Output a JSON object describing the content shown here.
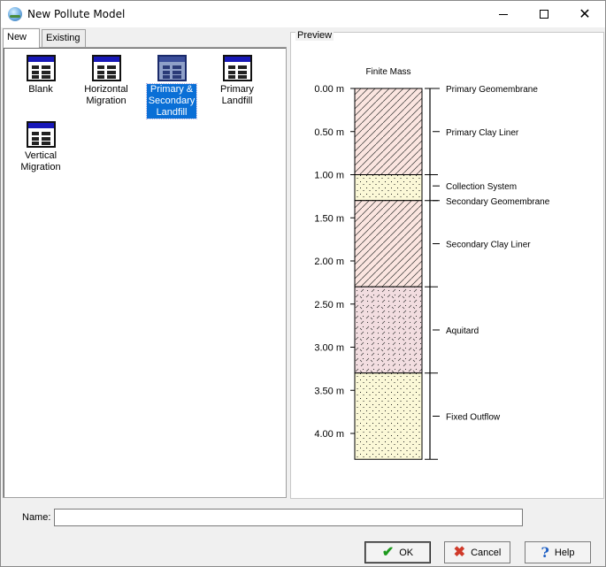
{
  "window": {
    "title": "New Pollute Model"
  },
  "tabs": [
    {
      "label": "New"
    },
    {
      "label": "Existing"
    }
  ],
  "models": [
    {
      "label_lines": [
        "Blank"
      ]
    },
    {
      "label_lines": [
        "Horizontal",
        "Migration"
      ]
    },
    {
      "label_lines": [
        "Primary &",
        "Secondary",
        "Landfill"
      ],
      "selected": true
    },
    {
      "label_lines": [
        "Primary",
        "Landfill"
      ]
    },
    {
      "label_lines": [
        "Vertical",
        "Migration"
      ]
    }
  ],
  "preview": {
    "legend": "Preview",
    "column_title": "Finite Mass",
    "depth_ticks": [
      "0.00 m",
      "0.50 m",
      "1.00 m",
      "1.50 m",
      "2.00 m",
      "2.50 m",
      "3.00 m",
      "3.50 m",
      "4.00 m"
    ],
    "tick_values": [
      0,
      0.5,
      1,
      1.5,
      2,
      2.5,
      3,
      3.5,
      4
    ],
    "max_depth": 4.3,
    "layers": [
      {
        "top": 0.0,
        "bottom": 1.0,
        "pattern": "clay"
      },
      {
        "top": 1.0,
        "bottom": 1.3,
        "pattern": "sand"
      },
      {
        "top": 1.3,
        "bottom": 2.3,
        "pattern": "clay"
      },
      {
        "top": 2.3,
        "bottom": 3.3,
        "pattern": "aquitard"
      },
      {
        "top": 3.3,
        "bottom": 4.3,
        "pattern": "sand"
      }
    ],
    "annotations": [
      {
        "label": "Primary Geomembrane",
        "depth": 0.0
      },
      {
        "label": "Primary Clay Liner",
        "depth": 0.5
      },
      {
        "label": "Collection System",
        "depth": 1.13
      },
      {
        "label": "Secondary Geomembrane",
        "depth": 1.3
      },
      {
        "label": "Secondary Clay Liner",
        "depth": 1.8
      },
      {
        "label": "Aquitard",
        "depth": 2.8
      },
      {
        "label": "Fixed Outflow",
        "depth": 3.8
      }
    ],
    "colors": {
      "clay": "#fbe5e0",
      "sand": "#fbf8d7",
      "aquitard": "#f2dde0"
    }
  },
  "form": {
    "name_label": "Name:",
    "name_value": ""
  },
  "buttons": {
    "ok": "OK",
    "cancel": "Cancel",
    "help": "Help"
  }
}
